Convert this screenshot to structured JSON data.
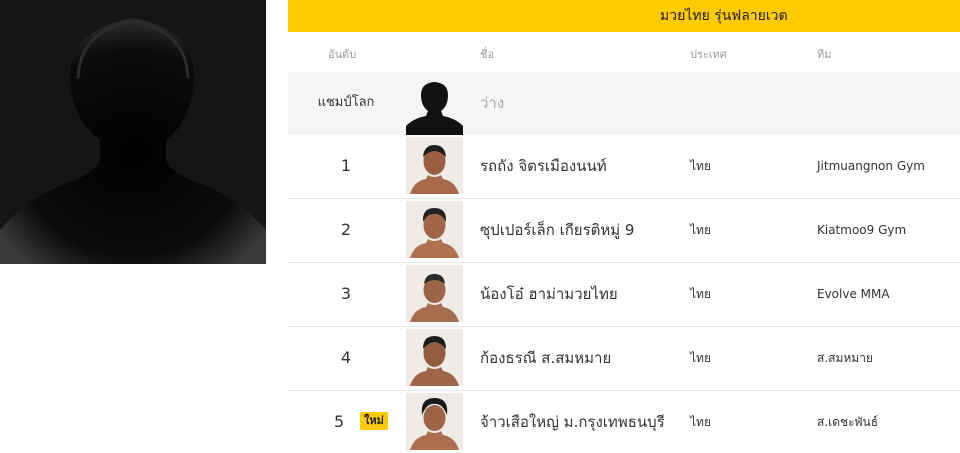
{
  "division": {
    "title": "มวยไทย รุ่นฟลายเวต"
  },
  "columns": {
    "rank": "อันดับ",
    "name": "ชื่อ",
    "country": "ประเทศ",
    "team": "ทีม"
  },
  "champion": {
    "label": "แชมป์โลก",
    "name": "ว่าง"
  },
  "rows": [
    {
      "rank": "1",
      "name": "รถถัง จิตรเมืองนนท์",
      "country": "ไทย",
      "team": "Jitmuangnon Gym"
    },
    {
      "rank": "2",
      "name": "ซุปเปอร์เล็ก เกียรติหมู่ 9",
      "country": "ไทย",
      "team": "Kiatmoo9 Gym"
    },
    {
      "rank": "3",
      "name": "น้องโอ๋ ฮาม่ามวยไทย",
      "country": "ไทย",
      "team": "Evolve MMA"
    },
    {
      "rank": "4",
      "name": "ก้องธรณี ส.สมหมาย",
      "country": "ไทย",
      "team": "ส.สมหมาย"
    },
    {
      "rank": "5",
      "badge": "ใหม่",
      "name": "จ้าวเสือใหญ่ ม.กรุงเทพธนบุรี",
      "country": "ไทย",
      "team": "ส.เดชะพันธ์"
    }
  ],
  "icons": {
    "hero": "fighter-silhouette",
    "champ_avatar": "silhouette-icon",
    "fighter_avatar": "fighter-headshot"
  },
  "colors": {
    "accent": "#fecb00",
    "champ_row_bg": "#f5f5f5",
    "vacant_text": "#a8a8a8"
  }
}
